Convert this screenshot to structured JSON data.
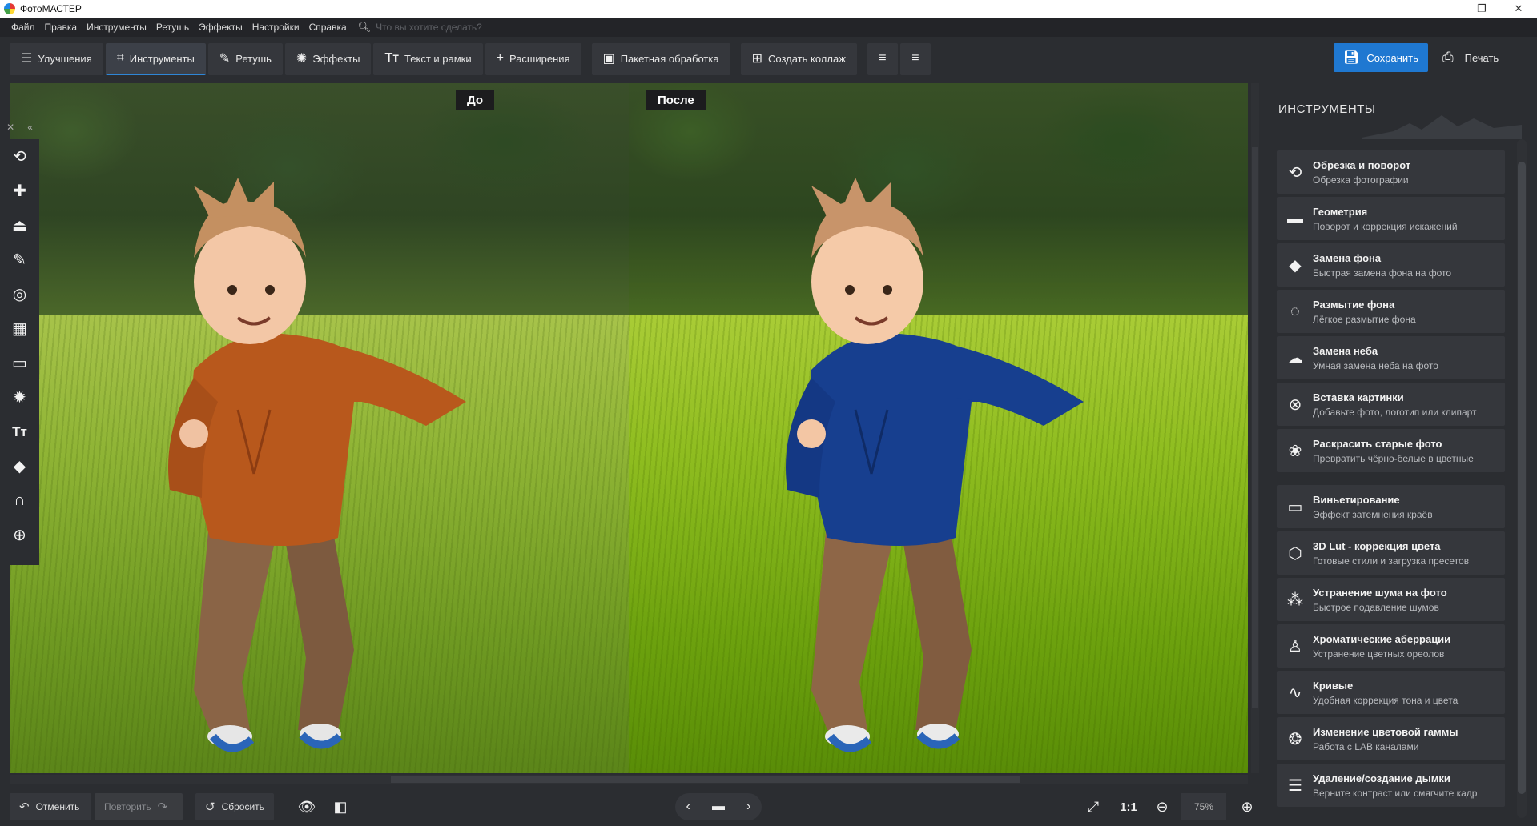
{
  "app": {
    "title": "ФотоМАСТЕР"
  },
  "window_controls": {
    "minimize": "–",
    "maximize": "❐",
    "close": "✕"
  },
  "menu": [
    "Файл",
    "Правка",
    "Инструменты",
    "Ретушь",
    "Эффекты",
    "Настройки",
    "Справка"
  ],
  "search": {
    "placeholder": "Что вы хотите сделать?"
  },
  "toolbar": {
    "tabs": [
      {
        "label": "Улучшения",
        "icon": "sliders-icon",
        "active": false
      },
      {
        "label": "Инструменты",
        "icon": "crop-icon",
        "active": true
      },
      {
        "label": "Ретушь",
        "icon": "brush-icon",
        "active": false
      },
      {
        "label": "Эффекты",
        "icon": "sparkle-icon",
        "active": false
      },
      {
        "label": "Текст и рамки",
        "icon": "text-icon",
        "active": false
      },
      {
        "label": "Расширения",
        "icon": "plus-icon",
        "active": false
      }
    ],
    "batch_label": "Пакетная обработка",
    "collage_label": "Создать коллаж",
    "save_label": "Сохранить",
    "print_label": "Печать"
  },
  "compare": {
    "before_label": "До",
    "after_label": "После"
  },
  "colors": {
    "accent": "#1f78d1",
    "shirt_before": "#b8581c",
    "shirt_after": "#173f8f"
  },
  "tools_panel": {
    "header": "ИНСТРУМЕНТЫ",
    "items": [
      {
        "title": "Обрезка и поворот",
        "subtitle": "Обрезка фотографии",
        "icon": "crop-rotate-icon"
      },
      {
        "title": "Геометрия",
        "subtitle": "Поворот и коррекция искажений",
        "icon": "geometry-icon"
      },
      {
        "title": "Замена фона",
        "subtitle": "Быстрая замена фона на фото",
        "icon": "fill-bucket-icon"
      },
      {
        "title": "Размытие фона",
        "subtitle": "Лёгкое размытие фона",
        "icon": "blur-icon"
      },
      {
        "title": "Замена неба",
        "subtitle": "Умная замена неба на фото",
        "icon": "cloud-icon"
      },
      {
        "title": "Вставка картинки",
        "subtitle": "Добавьте фото, логотип или клипарт",
        "icon": "insert-image-icon"
      },
      {
        "title": "Раскрасить старые фото",
        "subtitle": "Превратить чёрно-белые в цветные",
        "icon": "colorize-icon"
      },
      {
        "title": "Виньетирование",
        "subtitle": "Эффект затемнения краёв",
        "icon": "vignette-icon"
      },
      {
        "title": "3D Lut - коррекция цвета",
        "subtitle": "Готовые стили и загрузка пресетов",
        "icon": "cube-icon"
      },
      {
        "title": "Устранение шума на фото",
        "subtitle": "Быстрое подавление шумов",
        "icon": "noise-icon"
      },
      {
        "title": "Хроматические аберрации",
        "subtitle": "Устранение цветных ореолов",
        "icon": "person-icon"
      },
      {
        "title": "Кривые",
        "subtitle": "Удобная коррекция тона и цвета",
        "icon": "curves-icon"
      },
      {
        "title": "Изменение цветовой гаммы",
        "subtitle": "Работа с LAB каналами",
        "icon": "aperture-icon"
      },
      {
        "title": "Удаление/создание дымки",
        "subtitle": "Верните контраст или смягчите кадр",
        "icon": "haze-icon"
      }
    ]
  },
  "bottom": {
    "undo_label": "Отменить",
    "redo_label": "Повторить",
    "reset_label": "Сбросить",
    "one_to_one": "1:1",
    "zoom": "75%"
  }
}
